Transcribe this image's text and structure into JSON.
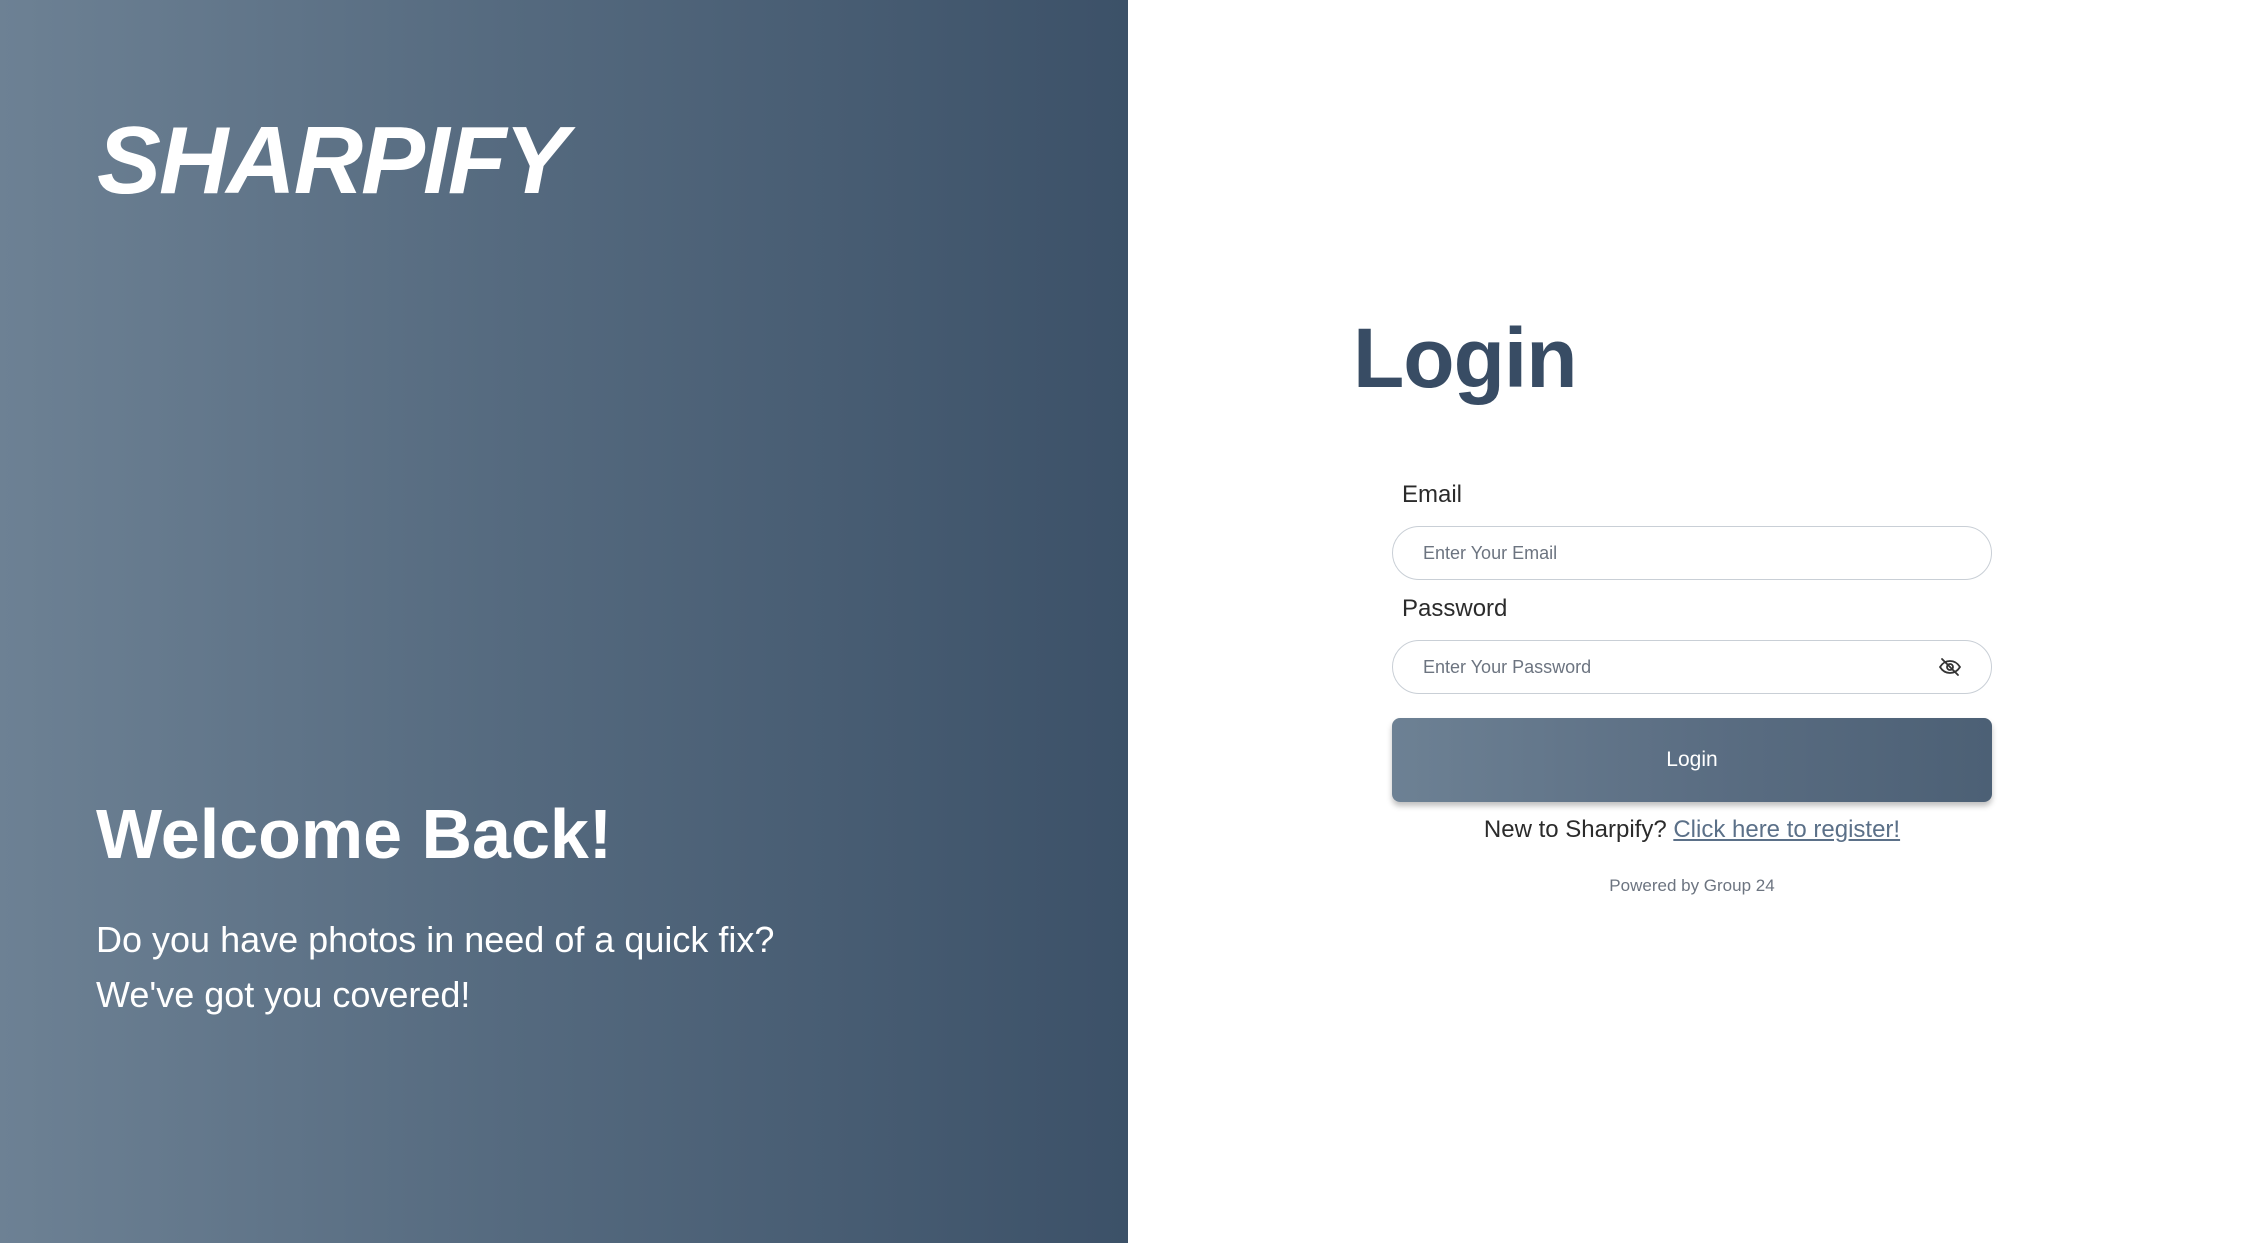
{
  "hero": {
    "brand": "SHARPIFY",
    "welcome_title": "Welcome Back!",
    "welcome_text": "Do you have photos in need of a quick fix? We've got you covered!"
  },
  "login": {
    "title": "Login",
    "email_label": "Email",
    "email_placeholder": "Enter Your Email",
    "email_value": "",
    "password_label": "Password",
    "password_placeholder": "Enter Your Password",
    "password_value": "",
    "password_toggle_icon": "eye-slash-icon",
    "button_label": "Login",
    "register_prompt": "New to Sharpify? ",
    "register_link": "Click here to register!",
    "powered_by": "Powered by Group 24"
  },
  "colors": {
    "accent": "#384c64",
    "hero_gradient_start": "#6d8194",
    "hero_gradient_end": "#3c5168",
    "link": "#5b7088"
  }
}
